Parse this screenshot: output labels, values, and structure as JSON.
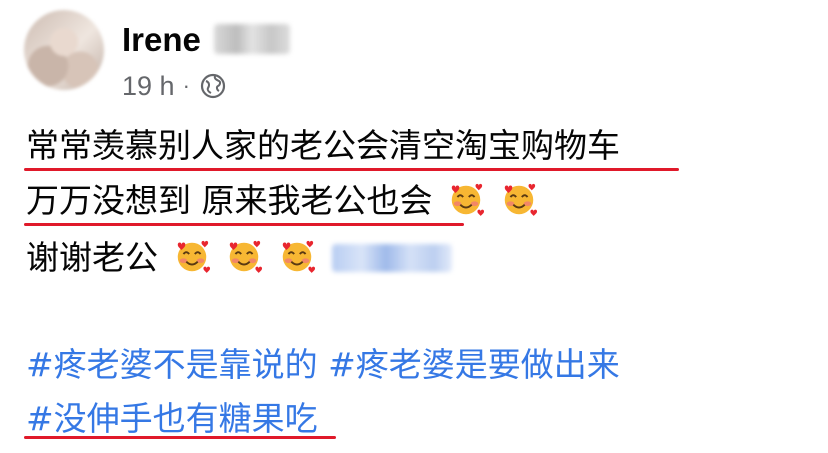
{
  "post": {
    "author": "Irene",
    "time": "19 h",
    "separator": "·",
    "privacy_icon": "globe-icon",
    "lines": [
      "常常羡慕别人家的老公会清空淘宝购物车",
      "万万没想到 原来我老公也会",
      "谢谢老公"
    ],
    "hashtags": [
      "#疼老婆不是靠说的 #疼老婆是要做出来",
      "#没伸手也有糖果吃"
    ],
    "emoji_icon": "smiling-face-with-hearts-icon"
  },
  "colors": {
    "text": "#050505",
    "meta": "#65676b",
    "hashtag": "#3578e5",
    "underline": "#e0192a"
  }
}
